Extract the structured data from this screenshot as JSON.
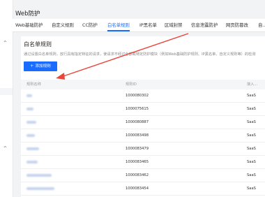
{
  "page_title": "Web防护",
  "tabs": [
    {
      "label": "Web基础防护"
    },
    {
      "label": "自定义规则"
    },
    {
      "label": "CC防护"
    },
    {
      "label": "白名单规则",
      "active": true
    },
    {
      "label": "IP黑名单"
    },
    {
      "label": "区域封禁"
    },
    {
      "label": "信息泄露防护"
    },
    {
      "label": "网页防篡改"
    },
    {
      "label": "自..."
    }
  ],
  "section": {
    "title": "白名单规则",
    "description": "通过设置白名单规则，放行具有指定特征的请求，使请求不经过全部或特定防护模块（例如Web基础防护规则、IP黑名单、自定义规则等）的检测",
    "add_button_label": "添加规则",
    "add_button_icon": "plus-icon"
  },
  "table": {
    "columns": [
      "规则名称",
      "规则ID",
      "接入..."
    ],
    "rows": [
      {
        "id": "1000080302",
        "access": "SaaS"
      },
      {
        "id": "1000075615",
        "access": "SaaS"
      },
      {
        "id": "1000080887",
        "access": "SaaS"
      },
      {
        "id": "1000083498",
        "access": "SaaS"
      },
      {
        "id": "1000083479",
        "access": "SaaS"
      },
      {
        "id": "1000083465",
        "access": "SaaS"
      },
      {
        "id": "1000083462",
        "access": "SaaS"
      },
      {
        "id": "1000083454",
        "access": "SaaS"
      }
    ]
  },
  "annotation": {
    "color": "#e8463c"
  },
  "colors": {
    "accent": "#1a6cff",
    "background": "#f2f3f5"
  }
}
